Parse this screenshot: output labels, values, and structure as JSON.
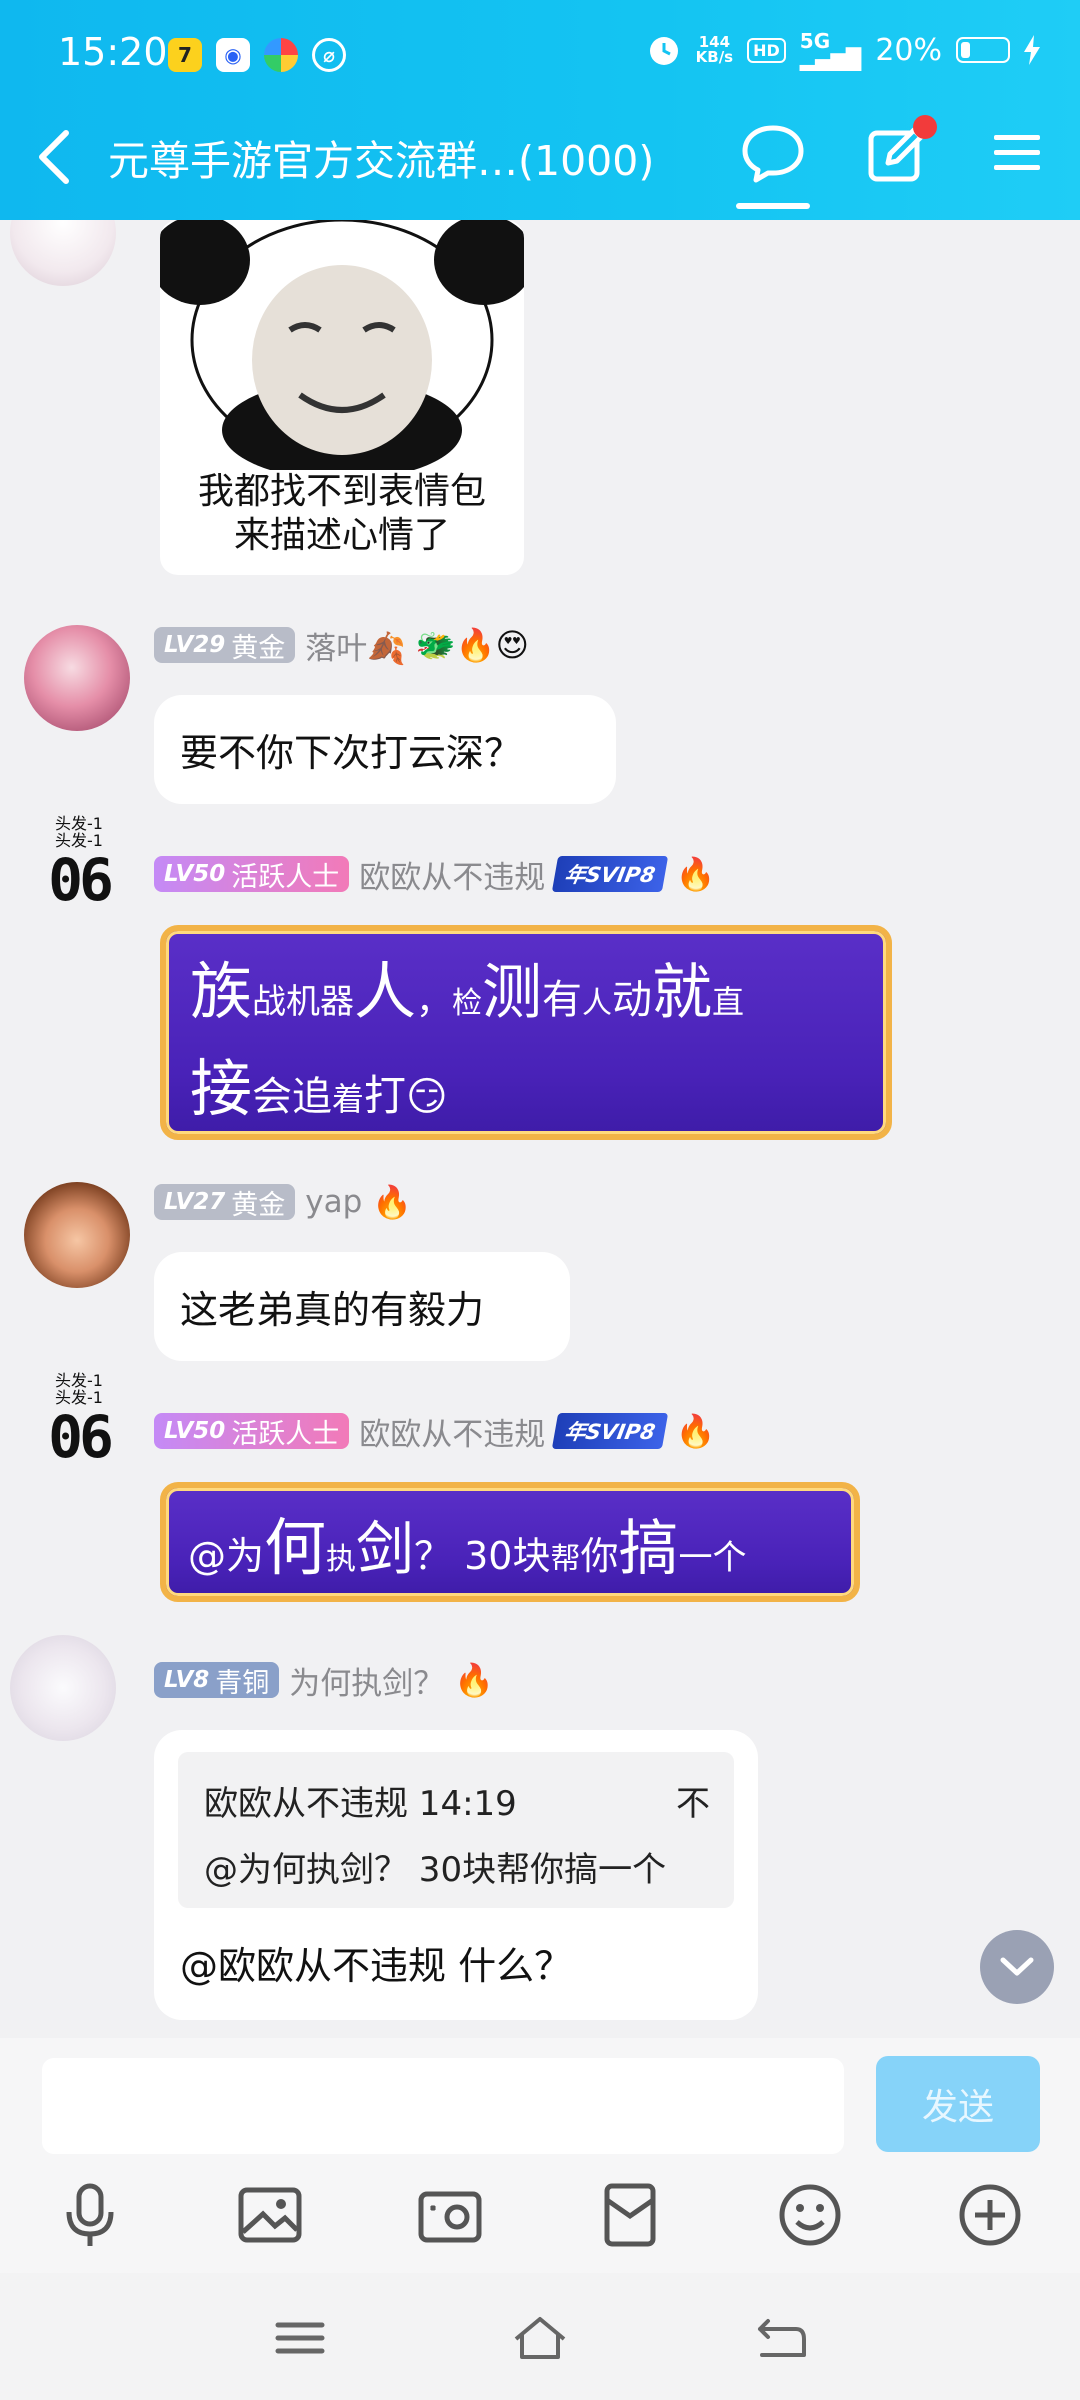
{
  "status_bar": {
    "time": "15:20",
    "speed_top": "144",
    "speed_unit": "KB/s",
    "hd": "HD",
    "network": "5G",
    "battery_percent": "20%",
    "battery_level": 0.2
  },
  "navbar": {
    "title": "元尊手游官方交流群…(1000)"
  },
  "messages": [
    {
      "sticker_line1": "我都找不到表情包",
      "sticker_line2": "来描述心情了"
    },
    {
      "level": "LV29",
      "title": "黄金",
      "nickname": "落叶🍂",
      "badges": "🐲🔥😍",
      "text": "要不你下次打云深？"
    },
    {
      "avatar_text": "06",
      "avatar_caption": "头发-1",
      "level": "LV50",
      "title": "活跃人士",
      "nickname": "欧欧从不违规",
      "svip": "年SVIP8",
      "flame": "🔥",
      "text_parts": [
        "族",
        "战机器",
        "人",
        "，",
        "检",
        "测",
        "有",
        "人",
        "动",
        "就",
        "直",
        "接",
        "会追",
        "着",
        "打",
        "😏"
      ]
    },
    {
      "level": "LV27",
      "title": "黄金",
      "nickname": "yap",
      "flame": "🔥",
      "text": "这老弟真的有毅力"
    },
    {
      "avatar_text": "06",
      "avatar_caption": "头发-1",
      "level": "LV50",
      "title": "活跃人士",
      "nickname": "欧欧从不违规",
      "svip": "年SVIP8",
      "flame": "🔥",
      "text_parts": [
        "@为",
        "何",
        "执",
        "剑",
        "？ 30块",
        "帮",
        "你",
        "搞",
        "一个"
      ]
    },
    {
      "level": "LV8",
      "title": "青铜",
      "nickname": "为何执剑？",
      "flame": "🔥",
      "quote_header": "欧欧从不违规 14:19",
      "quote_icon": "不",
      "quote_text": "@为何执剑？ 30块帮你搞一个",
      "text": "@欧欧从不违规 什么？"
    }
  ],
  "input": {
    "placeholder": "",
    "send_label": "发送"
  },
  "colors": {
    "header": "#14c4f2",
    "bubble": "#ffffff",
    "purple_bubble": "#4922b8",
    "send_disabled": "#86d3f9"
  },
  "icons": [
    "back-icon",
    "chat-bubble-icon",
    "edit-icon",
    "menu-icon",
    "microphone-icon",
    "image-icon",
    "camera-icon",
    "red-packet-icon",
    "emoji-icon",
    "plus-icon",
    "chevron-down-icon"
  ]
}
